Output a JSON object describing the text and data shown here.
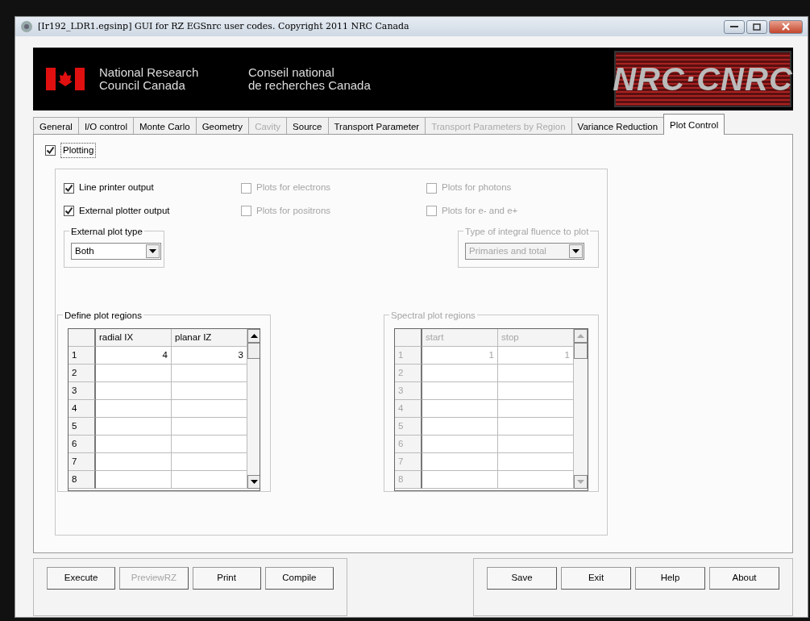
{
  "window": {
    "title": "[Ir192_LDR1.egsinp] GUI for RZ EGSnrc user codes. Copyright 2011 NRC Canada"
  },
  "banner": {
    "english": [
      "National Research",
      "Council Canada"
    ],
    "french": [
      "Conseil national",
      "de recherches Canada"
    ],
    "logo": "NRC·CNRC"
  },
  "tabs": [
    {
      "label": "General",
      "selected": false,
      "disabled": false
    },
    {
      "label": "I/O control",
      "selected": false,
      "disabled": false
    },
    {
      "label": "Monte Carlo",
      "selected": false,
      "disabled": false
    },
    {
      "label": "Geometry",
      "selected": false,
      "disabled": false
    },
    {
      "label": "Cavity",
      "selected": false,
      "disabled": true
    },
    {
      "label": "Source",
      "selected": false,
      "disabled": false
    },
    {
      "label": "Transport Parameter",
      "selected": false,
      "disabled": false
    },
    {
      "label": "Transport Parameters by Region",
      "selected": false,
      "disabled": true
    },
    {
      "label": "Variance Reduction",
      "selected": false,
      "disabled": false
    },
    {
      "label": "Plot Control",
      "selected": true,
      "disabled": false
    }
  ],
  "plotting": {
    "label": "Plotting",
    "checked": true
  },
  "options": [
    {
      "label": "Line printer output",
      "checked": true,
      "disabled": false
    },
    {
      "label": "Plots for electrons",
      "checked": false,
      "disabled": true
    },
    {
      "label": "Plots for photons",
      "checked": false,
      "disabled": true
    },
    {
      "label": "External plotter output",
      "checked": true,
      "disabled": false
    },
    {
      "label": "Plots for positrons",
      "checked": false,
      "disabled": true
    },
    {
      "label": "Plots for e- and e+",
      "checked": false,
      "disabled": true
    }
  ],
  "external_plot_type": {
    "title": "External plot type",
    "value": "Both",
    "disabled": false
  },
  "fluence_type": {
    "title": "Type of integral fluence to plot",
    "value": "Primaries and total",
    "disabled": true
  },
  "tables": [
    {
      "title": "Define plot regions",
      "disabled": false,
      "columns": [
        "radial IX",
        "planar IZ"
      ],
      "rows": [
        {
          "header": "1",
          "cells": [
            "4",
            "3"
          ]
        },
        {
          "header": "2",
          "cells": []
        },
        {
          "header": "3",
          "cells": []
        },
        {
          "header": "4",
          "cells": []
        },
        {
          "header": "5",
          "cells": []
        },
        {
          "header": "6",
          "cells": []
        },
        {
          "header": "7",
          "cells": []
        },
        {
          "header": "8",
          "cells": []
        }
      ]
    },
    {
      "title": "Spectral plot regions",
      "disabled": true,
      "columns": [
        "start",
        "stop"
      ],
      "rows": [
        {
          "header": "1",
          "cells": [
            "1",
            "1"
          ]
        },
        {
          "header": "2",
          "cells": []
        },
        {
          "header": "3",
          "cells": []
        },
        {
          "header": "4",
          "cells": []
        },
        {
          "header": "5",
          "cells": []
        },
        {
          "header": "6",
          "cells": []
        },
        {
          "header": "7",
          "cells": []
        },
        {
          "header": "8",
          "cells": []
        }
      ]
    }
  ],
  "left_buttons": [
    {
      "label": "Execute",
      "disabled": false
    },
    {
      "label": "PreviewRZ",
      "disabled": true
    },
    {
      "label": "Print",
      "disabled": false
    },
    {
      "label": "Compile",
      "disabled": false
    }
  ],
  "right_buttons": [
    {
      "label": "Save",
      "disabled": false
    },
    {
      "label": "Exit",
      "disabled": false
    },
    {
      "label": "Help",
      "disabled": false
    },
    {
      "label": "About",
      "disabled": false
    }
  ]
}
